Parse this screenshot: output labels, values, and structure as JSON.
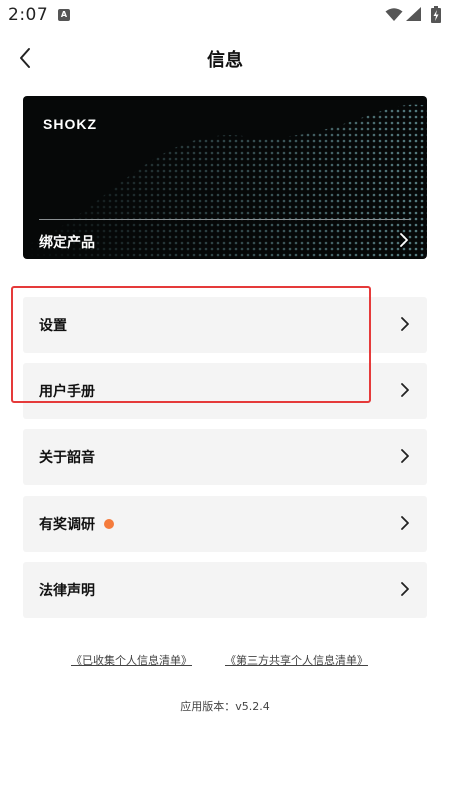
{
  "status": {
    "time": "2:07",
    "a_badge": "A"
  },
  "header": {
    "title": "信息"
  },
  "banner": {
    "brand": "SHOKZ",
    "label": "绑定产品"
  },
  "menu": [
    {
      "label": "设置"
    },
    {
      "label": "用户手册"
    },
    {
      "label": "关于韶音"
    },
    {
      "label": "有奖调研",
      "badge": true,
      "badge_color": "#f47b3c"
    },
    {
      "label": "法律声明"
    }
  ],
  "highlight": {
    "color": "#e53a3a"
  },
  "footer": {
    "link1": "《已收集个人信息清单》",
    "link2": "《第三方共享个人信息清单》",
    "version_label": "应用版本：",
    "version": "v5.2.4"
  }
}
